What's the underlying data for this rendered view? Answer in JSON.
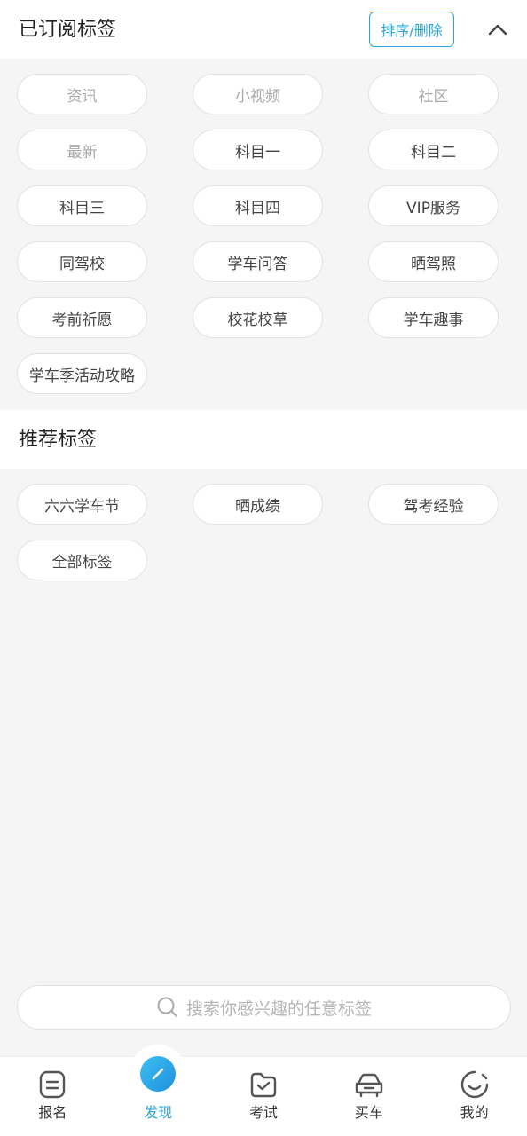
{
  "subscribed": {
    "title": "已订阅标签",
    "sort_delete_label": "排序/删除",
    "tags": [
      {
        "label": "资讯",
        "fixed": true
      },
      {
        "label": "小视频",
        "fixed": true
      },
      {
        "label": "社区",
        "fixed": true
      },
      {
        "label": "最新",
        "fixed": true
      },
      {
        "label": "科目一",
        "fixed": false
      },
      {
        "label": "科目二",
        "fixed": false
      },
      {
        "label": "科目三",
        "fixed": false
      },
      {
        "label": "科目四",
        "fixed": false
      },
      {
        "label": "VIP服务",
        "fixed": false
      },
      {
        "label": "同驾校",
        "fixed": false
      },
      {
        "label": "学车问答",
        "fixed": false
      },
      {
        "label": "晒驾照",
        "fixed": false
      },
      {
        "label": "考前祈愿",
        "fixed": false
      },
      {
        "label": "校花校草",
        "fixed": false
      },
      {
        "label": "学车趣事",
        "fixed": false
      },
      {
        "label": "学车季活动攻略",
        "fixed": false
      }
    ]
  },
  "recommended": {
    "title": "推荐标签",
    "tags": [
      {
        "label": "六六学车节"
      },
      {
        "label": "晒成绩"
      },
      {
        "label": "驾考经验"
      },
      {
        "label": "全部标签"
      }
    ]
  },
  "search": {
    "placeholder": "搜索你感兴趣的任意标签"
  },
  "nav": {
    "items": [
      {
        "label": "报名",
        "icon": "signup-icon",
        "active": false
      },
      {
        "label": "发现",
        "icon": "discover-icon",
        "active": true
      },
      {
        "label": "考试",
        "icon": "exam-icon",
        "active": false
      },
      {
        "label": "买车",
        "icon": "car-icon",
        "active": false
      },
      {
        "label": "我的",
        "icon": "profile-icon",
        "active": false
      }
    ]
  },
  "colors": {
    "accent": "#2aa7d8",
    "background": "#f5f5f5"
  }
}
